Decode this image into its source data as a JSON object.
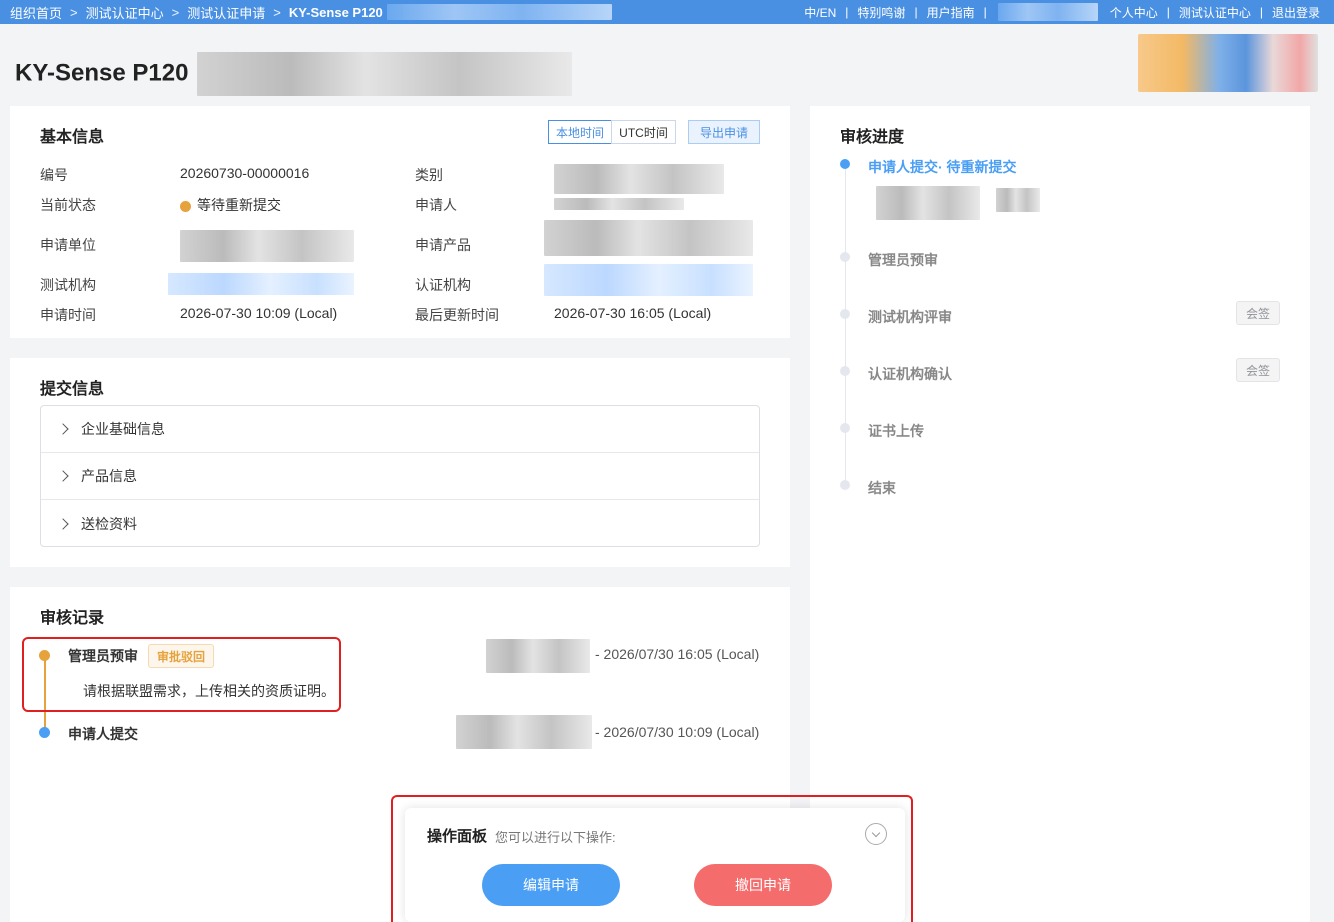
{
  "breadcrumbs": [
    "组织首页",
    "测试认证中心",
    "测试认证申请",
    "KY-Sense P120"
  ],
  "topnav": [
    "中/EN",
    "特别鸣谢",
    "用户指南",
    "个人中心",
    "测试认证中心",
    "退出登录"
  ],
  "page_title": "KY-Sense P120",
  "basic_info": {
    "title": "基本信息",
    "local_time": "本地时间",
    "utc_time": "UTC时间",
    "export": "导出申请",
    "fields": {
      "number_label": "编号",
      "number_value": "20260730-00000016",
      "category_label": "类别",
      "status_label": "当前状态",
      "status_value": "等待重新提交",
      "applicant_label": "申请人",
      "unit_label": "申请单位",
      "product_label": "申请产品",
      "test_org_label": "测试机构",
      "cert_org_label": "认证机构",
      "apply_time_label": "申请时间",
      "apply_time_value": "2026-07-30 10:09 (Local)",
      "update_time_label": "最后更新时间",
      "update_time_value": "2026-07-30 16:05 (Local)"
    }
  },
  "submit_info": {
    "title": "提交信息",
    "items": [
      "企业基础信息",
      "产品信息",
      "送检资料"
    ]
  },
  "review_records": {
    "title": "审核记录",
    "items": [
      {
        "stage": "管理员预审",
        "tag": "审批驳回",
        "time": "- 2026/07/30 16:05 (Local)",
        "comment": "请根据联盟需求，上传相关的资质证明。"
      },
      {
        "stage": "申请人提交",
        "time": "- 2026/07/30 10:09 (Local)"
      }
    ]
  },
  "progress": {
    "title": "审核进度",
    "steps": [
      {
        "label": "申请人提交· 待重新提交"
      },
      {
        "label": "管理员预审"
      },
      {
        "label": "测试机构评审",
        "tag": "会签"
      },
      {
        "label": "认证机构确认",
        "tag": "会签"
      },
      {
        "label": "证书上传"
      },
      {
        "label": "结束"
      }
    ]
  },
  "op_panel": {
    "title": "操作面板",
    "subtitle": "您可以进行以下操作:",
    "edit": "编辑申请",
    "withdraw": "撤回申请"
  },
  "colors": {
    "topbar": "#4a90e2",
    "primary": "#4a9ff5",
    "danger": "#f56c6c",
    "warning": "#e6a23c"
  }
}
